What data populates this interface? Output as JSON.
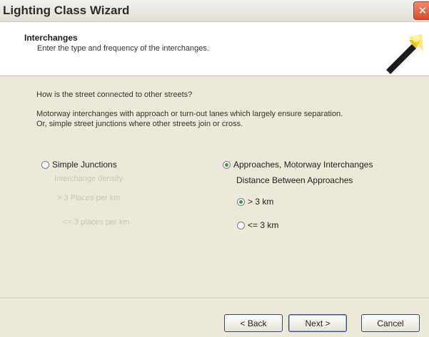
{
  "window": {
    "title": "Lighting Class Wizard",
    "close_icon": "close-icon"
  },
  "header": {
    "title": "Interchanges",
    "subtitle": "Enter the type and frequency of the interchanges.",
    "icon": "wizard-wand-icon"
  },
  "content": {
    "question": "How is the street connected to other streets?",
    "description_line1": "Motorway interchanges with approach or turn-out lanes which largely ensure separation.",
    "description_line2": "Or, simple street junctions where other streets join or cross."
  },
  "options": {
    "simple_junctions": {
      "label": "Simple Junctions",
      "checked": false
    },
    "approaches": {
      "label": "Approaches, Motorway Interchanges",
      "checked": true
    }
  },
  "simple_group": {
    "label": "Interchange density",
    "opt1": "> 3 Places per km",
    "opt2": "<= 3 places per km"
  },
  "approach_group": {
    "label": "Distance Between Approaches",
    "opt1": {
      "label": "> 3 km",
      "checked": true
    },
    "opt2": {
      "label": "<= 3 km",
      "checked": false
    }
  },
  "footer": {
    "back_label": "< Back",
    "next_label": "Next >",
    "cancel_label": "Cancel"
  }
}
